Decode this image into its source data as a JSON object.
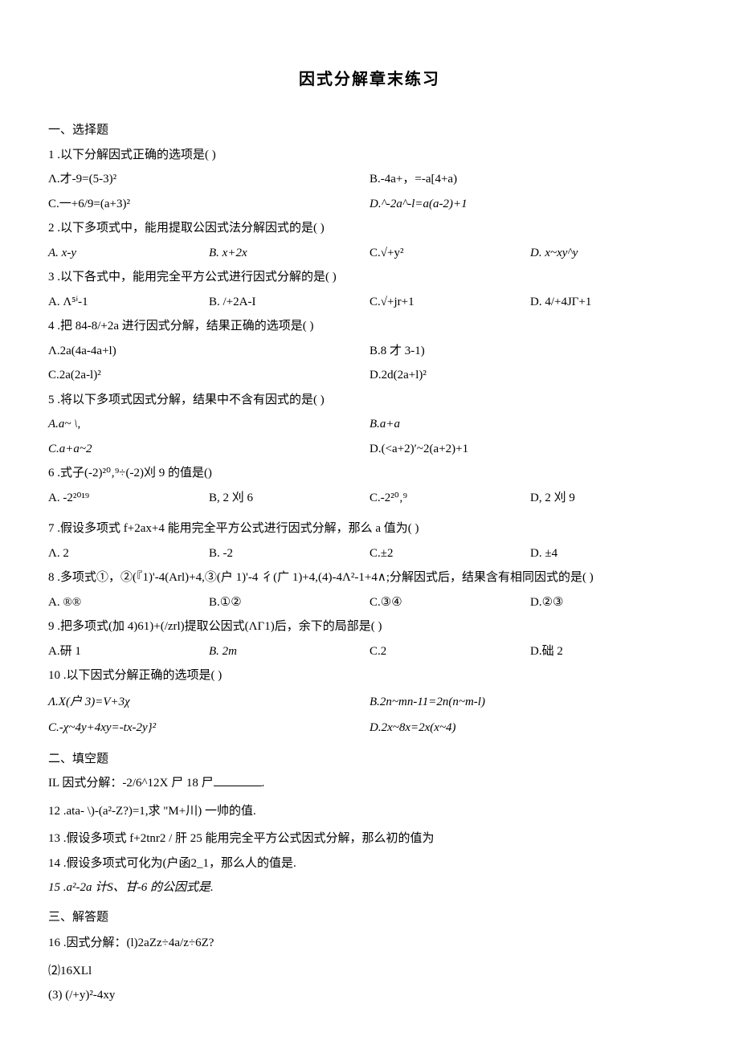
{
  "title": "因式分解章末练习",
  "sections": {
    "s1": "一、选择题",
    "s2": "二、填空题",
    "s3": "三、解答题"
  },
  "q1": {
    "stem": "1 .以下分解因式正确的选项是(        )",
    "a": "Λ.才-9=(5-3)²",
    "b": "B.-4a+，=-a[4+a)",
    "c": "C.一+6/9=(a+3)²",
    "d": "D.^-2a^-l=a(a-2)+1"
  },
  "q2": {
    "stem": "2 .以下多项式中，能用提取公因式法分解因式的是(        )",
    "a": "A.   x-y",
    "b": "B.   x+2x",
    "c": "C.√+y²",
    "d": "D.   x~xy^y"
  },
  "q3": {
    "stem": "3 .以下各式中，能用完全平方公式进行因式分解的是(        )",
    "a": "A.    Λ⁵ⁱ-1",
    "b": "B.   /+2A-I",
    "c": "C.√+jr+1",
    "d": "D.   4/+4JΓ+1"
  },
  "q4": {
    "stem": "4 .把 84-8/+2a 进行因式分解，结果正确的选项是(        )",
    "a": "Λ.2a(4a-4a+l)",
    "b": "B.8 才 3-1)",
    "c": "C.2a(2a-l)²",
    "d": "D.2d(2a+l)²"
  },
  "q5": {
    "stem": "5 .将以下多项式因式分解，结果中不含有因式的是(            )",
    "a": "A.a~ \\,",
    "b": "B.a+a",
    "c": "C.a+a~2",
    "d": "D.(<a+2)′~2(a+2)+1"
  },
  "q6": {
    "stem": "6 .式子(-2)²⁰‚⁹÷(-2)刈 9 的值是()",
    "a": "A.   -2²⁰¹⁹",
    "b": "B,   2 刈 6",
    "c": "C.-2²⁰‚⁹",
    "d": "D,   2 刈 9"
  },
  "q7": {
    "stem": "7 .假设多项式 f+2ax+4 能用完全平方公式进行因式分解，那么 a 值为(        )",
    "a": "Λ.   2",
    "b": "B.   -2",
    "c": "C.±2",
    "d": "D.   ±4"
  },
  "q8": {
    "stem": "  8 .多项式①，②(『1)'-4(Arl)+4,③(户 1)'-4 彳(广 1)+4,(4)-4Λ²-1+4∧;分解因式后，结果含有相同因式的是( )",
    "a": "A.   ®®",
    "b": "B.①②",
    "c": "C.③④",
    "d": "D.②③"
  },
  "q9": {
    "stem": "9 .把多项式(加 4)61)+(/zrl)提取公因式(ΛΓ1)后，余下的局部是(                    )",
    "a": "A.研 1",
    "b": "B.   2m",
    "c": "C.2",
    "d": "D.础 2"
  },
  "q10": {
    "stem": "10 .以下因式分解正确的选项是(        )",
    "a": "Λ.X(户 3)=V+3χ",
    "b": "B.2n~mn-11=2n(n~m-l)",
    "c": "C.-χ~4y+4xy=-tx-2y}²",
    "d": "D.2x~8x=2x(x~4)"
  },
  "q11": "IL 因式分解：-2/6^12X 尸 18 尸",
  "q11_end": ".",
  "q12": "12  .ata- \\)-(a²-Z?)=1,求 \"M+川) 一帅的值.",
  "q13": "13  .假设多项式 f+2tnr2 / 肝 25 能用完全平方公式因式分解，那么初的值为",
  "q14": "14  .假设多项式可化为(户函2_1，那么人的值是.",
  "q15": "15  .a²-2a 计S、甘-6 的公因式是.",
  "q16": "  16 .因式分解：(l)2aZz÷4a/z÷6Z?",
  "q16b": "⑵16XLl",
  "q16c": "(3)  (/+y)²-4xy"
}
